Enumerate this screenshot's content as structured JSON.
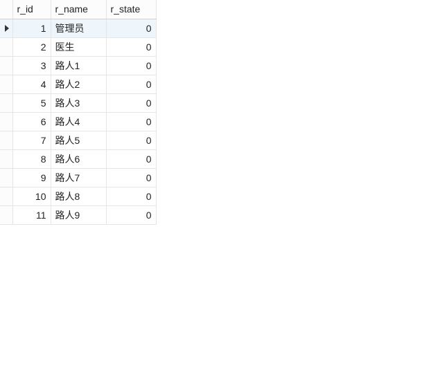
{
  "columns": {
    "id": "r_id",
    "name": "r_name",
    "state": "r_state"
  },
  "selected_index": 0,
  "rows": [
    {
      "id": 1,
      "name": "管理员",
      "state": 0
    },
    {
      "id": 2,
      "name": "医生",
      "state": 0
    },
    {
      "id": 3,
      "name": "路人1",
      "state": 0
    },
    {
      "id": 4,
      "name": "路人2",
      "state": 0
    },
    {
      "id": 5,
      "name": "路人3",
      "state": 0
    },
    {
      "id": 6,
      "name": "路人4",
      "state": 0
    },
    {
      "id": 7,
      "name": "路人5",
      "state": 0
    },
    {
      "id": 8,
      "name": "路人6",
      "state": 0
    },
    {
      "id": 9,
      "name": "路人7",
      "state": 0
    },
    {
      "id": 10,
      "name": "路人8",
      "state": 0
    },
    {
      "id": 11,
      "name": "路人9",
      "state": 0
    }
  ]
}
